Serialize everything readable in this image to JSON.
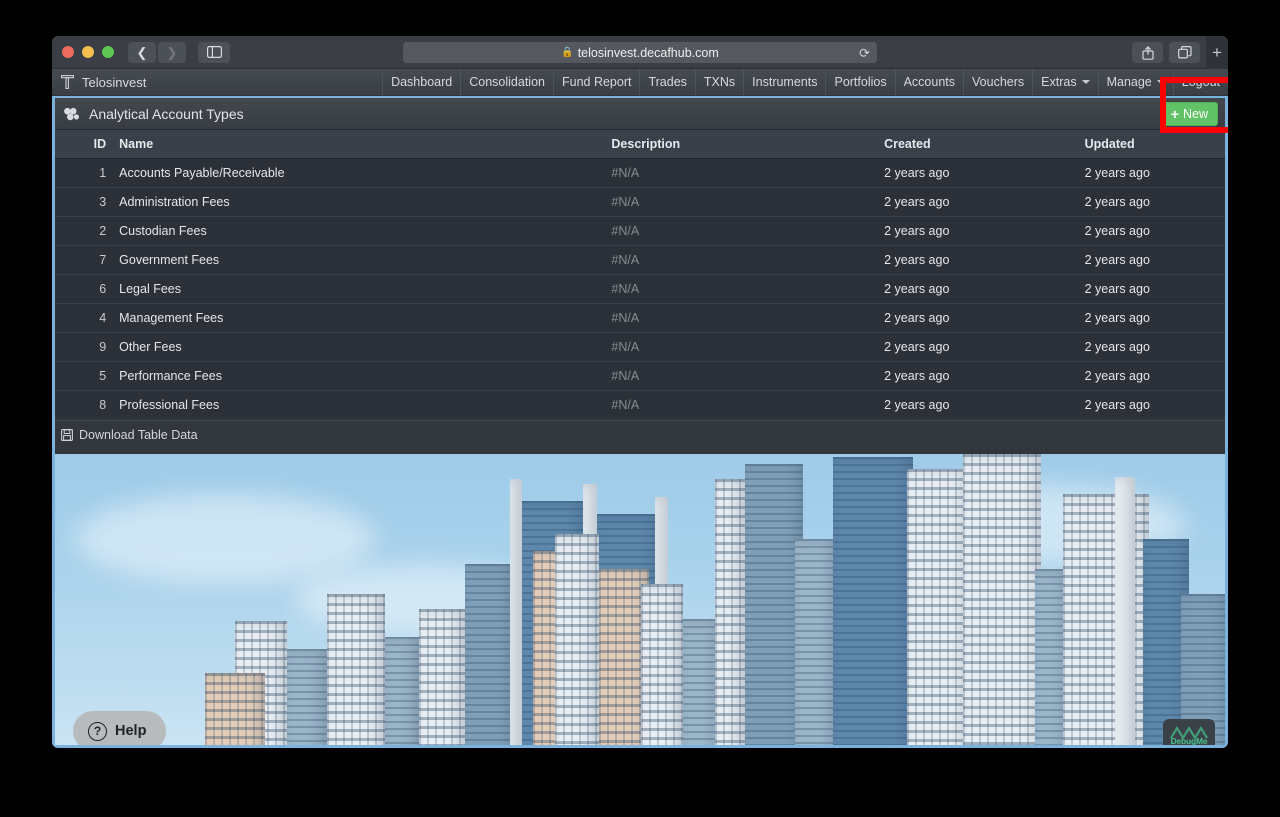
{
  "browser": {
    "url": "telosinvest.decafhub.com",
    "lock_icon": "lock-icon",
    "reload_icon": "reload-icon",
    "back_icon": "chevron-left-icon",
    "forward_icon": "chevron-right-icon",
    "sidebar_icon": "sidebar-toggle-icon",
    "share_icon": "share-icon",
    "tabs_icon": "show-tabs-icon",
    "newtab_label": "+"
  },
  "appbar": {
    "brand": "Telosinvest",
    "brand_icon": "telosinvest-logo-icon",
    "nav": [
      {
        "label": "Dashboard",
        "caret": false
      },
      {
        "label": "Consolidation",
        "caret": false
      },
      {
        "label": "Fund Report",
        "caret": false
      },
      {
        "label": "Trades",
        "caret": false
      },
      {
        "label": "TXNs",
        "caret": false
      },
      {
        "label": "Instruments",
        "caret": false
      },
      {
        "label": "Portfolios",
        "caret": false
      },
      {
        "label": "Accounts",
        "caret": false
      },
      {
        "label": "Vouchers",
        "caret": false
      },
      {
        "label": "Extras",
        "caret": true
      },
      {
        "label": "Manage",
        "caret": true
      },
      {
        "label": "Logout",
        "caret": false
      }
    ]
  },
  "panel": {
    "title": "Analytical Account Types",
    "title_icon": "cubes-icon",
    "new_button": "New",
    "new_button_plus": "+",
    "new_button_color": "#61c267",
    "annotation_color": "#ff0000"
  },
  "table": {
    "columns": [
      "ID",
      "Name",
      "Description",
      "Created",
      "Updated"
    ],
    "rows": [
      {
        "id": "1",
        "name": "Accounts Payable/Receivable",
        "description": "#N/A",
        "created": "2 years ago",
        "updated": "2 years ago"
      },
      {
        "id": "3",
        "name": "Administration Fees",
        "description": "#N/A",
        "created": "2 years ago",
        "updated": "2 years ago"
      },
      {
        "id": "2",
        "name": "Custodian Fees",
        "description": "#N/A",
        "created": "2 years ago",
        "updated": "2 years ago"
      },
      {
        "id": "7",
        "name": "Government Fees",
        "description": "#N/A",
        "created": "2 years ago",
        "updated": "2 years ago"
      },
      {
        "id": "6",
        "name": "Legal Fees",
        "description": "#N/A",
        "created": "2 years ago",
        "updated": "2 years ago"
      },
      {
        "id": "4",
        "name": "Management Fees",
        "description": "#N/A",
        "created": "2 years ago",
        "updated": "2 years ago"
      },
      {
        "id": "9",
        "name": "Other Fees",
        "description": "#N/A",
        "created": "2 years ago",
        "updated": "2 years ago"
      },
      {
        "id": "5",
        "name": "Performance Fees",
        "description": "#N/A",
        "created": "2 years ago",
        "updated": "2 years ago"
      },
      {
        "id": "8",
        "name": "Professional Fees",
        "description": "#N/A",
        "created": "2 years ago",
        "updated": "2 years ago"
      }
    ],
    "footer_link": "Download Table Data",
    "footer_icon": "save-disk-icon"
  },
  "widgets": {
    "help_label": "Help",
    "help_icon": "question-circle-icon",
    "debugme_label": "DebugMe",
    "debugme_icon": "debugme-logo-icon"
  }
}
